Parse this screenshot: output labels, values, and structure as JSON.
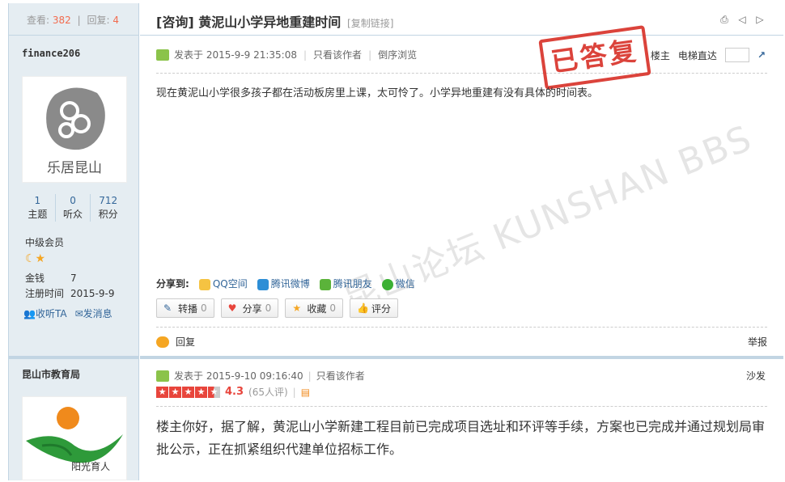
{
  "thread": {
    "views_label": "查看:",
    "views": "382",
    "replies_label": "回复:",
    "replies": "4",
    "title": "[咨询] 黄泥山小学异地重建时间",
    "copy_link": "[复制链接]"
  },
  "post1": {
    "author": "finance206",
    "stats": [
      {
        "value": "1",
        "label": "主题"
      },
      {
        "value": "0",
        "label": "听众"
      },
      {
        "value": "712",
        "label": "积分"
      }
    ],
    "rank": "中级会员",
    "gold_label": "金钱",
    "gold": "7",
    "reg_label": "注册时间",
    "reg_date": "2015-9-9",
    "follow": "收听TA",
    "message": "发消息",
    "posted": "发表于 2015-9-9 21:35:08",
    "only_author": "只看该作者",
    "reverse": "倒序浏览",
    "floor": "楼主",
    "elevator": "电梯直达",
    "stamp": "已答复",
    "watermark": "昆山论坛 KUNSHAN BBS",
    "content": "现在黄泥山小学很多孩子都在活动板房里上课，太可怜了。小学异地重建有没有具体的时间表。",
    "share_label": "分享到:",
    "share": [
      "QQ空间",
      "腾讯微博",
      "腾讯朋友",
      "微信"
    ],
    "actions": [
      {
        "label": "转播",
        "count": "0"
      },
      {
        "label": "分享",
        "count": "0"
      },
      {
        "label": "收藏",
        "count": "0"
      },
      {
        "label": "评分",
        "count": ""
      }
    ],
    "reply": "回复",
    "report": "举报"
  },
  "post2": {
    "author": "昆山市教育局",
    "avatar_text": "阳光育人",
    "posted": "发表于 2015-9-10 09:16:40",
    "only_author": "只看该作者",
    "floor": "沙发",
    "score": "4.3",
    "reviews": "(65人评)",
    "content": "楼主你好，据了解，黄泥山小学新建工程目前已完成项目选址和环评等手续，方案也已完成并通过规划局审批公示，正在抓紧组织代建单位招标工作。"
  },
  "colors": {
    "accent": "#336699",
    "stamp": "#d9342b",
    "sidebar_bg": "#e5edf2"
  }
}
